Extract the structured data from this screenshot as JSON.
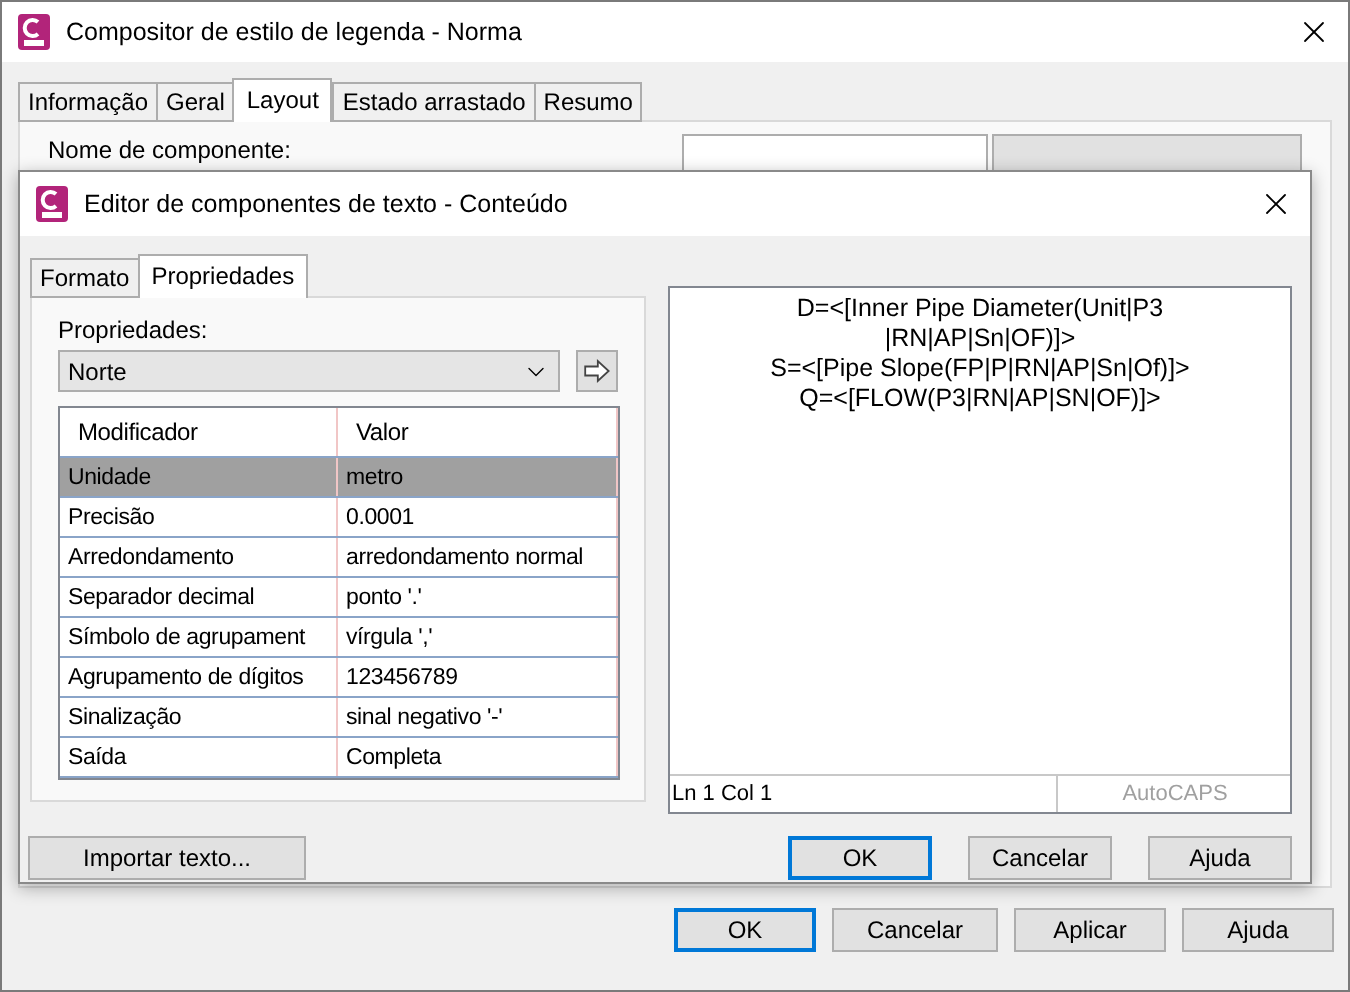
{
  "window": {
    "title": "Compositor de estilo de legenda - Norma"
  },
  "tabs": [
    {
      "label": "Informação",
      "selected": false
    },
    {
      "label": "Geral",
      "selected": false
    },
    {
      "label": "Layout",
      "selected": true
    },
    {
      "label": "Estado arrastado",
      "selected": false
    },
    {
      "label": "Resumo",
      "selected": false
    }
  ],
  "component_name": {
    "label": "Nome de componente:"
  },
  "buttons": [
    {
      "label": "OK",
      "default": true
    },
    {
      "label": "Cancelar",
      "default": false
    },
    {
      "label": "Aplicar",
      "default": false
    },
    {
      "label": "Ajuda",
      "default": false
    }
  ],
  "dialog": {
    "title": "Editor de componentes de texto - Conteúdo",
    "tabs": [
      {
        "label": "Formato",
        "selected": false
      },
      {
        "label": "Propriedades",
        "selected": true
      }
    ],
    "properties_label": "Propriedades:",
    "properties_value": "Norte",
    "table": {
      "columns": [
        "Modificador",
        "Valor"
      ],
      "rows": [
        {
          "modifier": "Unidade",
          "value": "metro",
          "selected": true
        },
        {
          "modifier": "Precisão",
          "value": "0.0001",
          "selected": false
        },
        {
          "modifier": "Arredondamento",
          "value": "arredondamento normal",
          "selected": false
        },
        {
          "modifier": "Separador decimal",
          "value": "ponto '.'",
          "selected": false
        },
        {
          "modifier": "Símbolo de agrupament",
          "value": "vírgula ','",
          "selected": false
        },
        {
          "modifier": "Agrupamento de dígitos",
          "value": "123456789",
          "selected": false
        },
        {
          "modifier": "Sinalização",
          "value": "sinal negativo '-'",
          "selected": false
        },
        {
          "modifier": "Saída",
          "value": "Completa",
          "selected": false
        }
      ]
    },
    "text_lines": [
      "D=<[Inner Pipe Diameter(Unit|P3",
      "|RN|AP|Sn|OF)]>",
      "S=<[Pipe Slope(FP|P|RN|AP|Sn|Of)]>",
      "Q=<[FLOW(P3|RN|AP|SN|OF)]>"
    ],
    "status": {
      "position": "Ln 1 Col 1",
      "autocaps": "AutoCAPS",
      "autocaps_disabled": true
    },
    "import_button": "Importar texto...",
    "buttons": [
      {
        "label": "OK",
        "default": true
      },
      {
        "label": "Cancelar",
        "default": false
      },
      {
        "label": "Ajuda",
        "default": false
      }
    ]
  }
}
